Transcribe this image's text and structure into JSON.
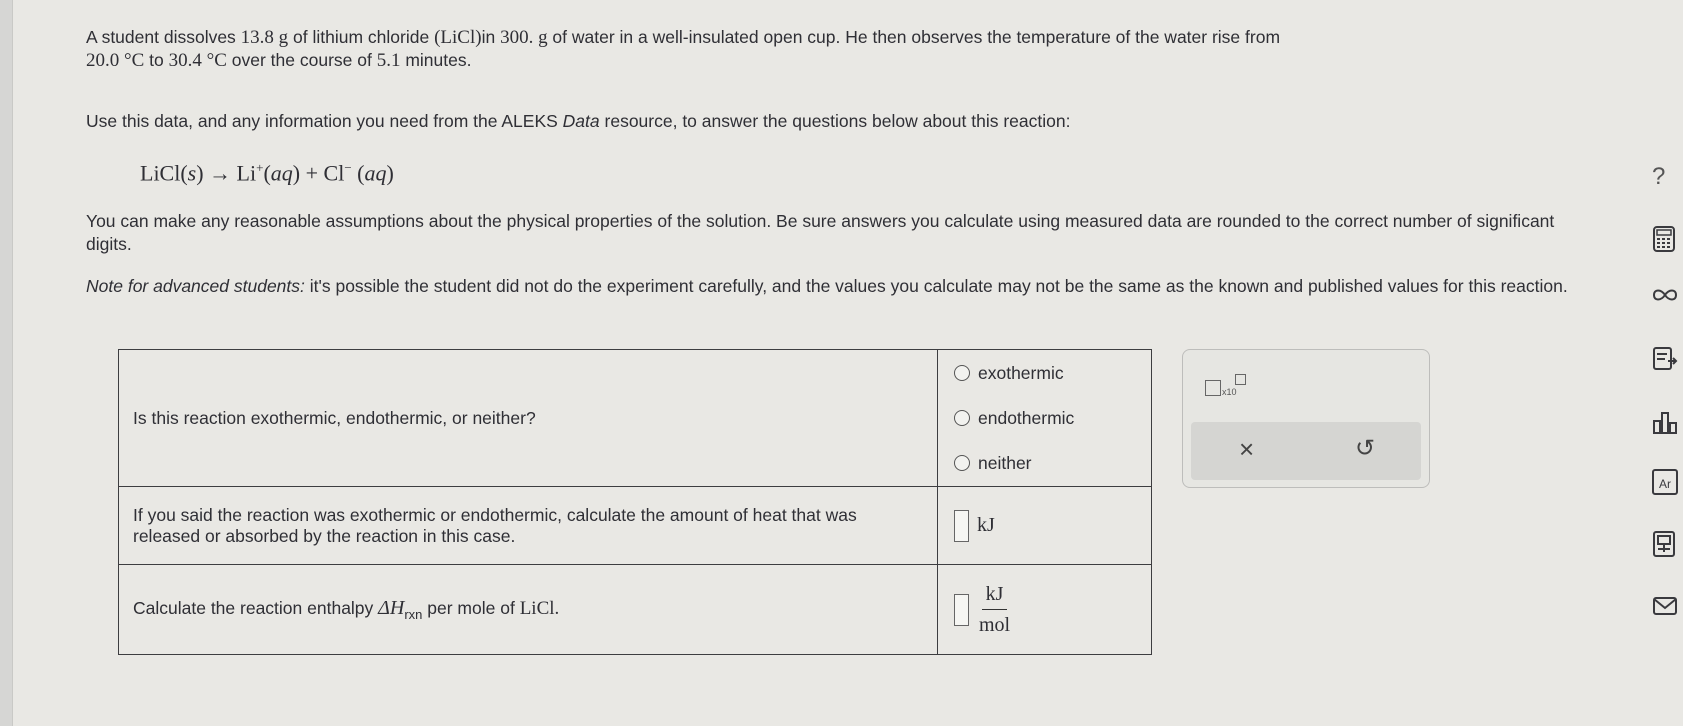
{
  "problem": {
    "p1_a": "A student dissolves ",
    "mass_value": "13.8",
    "mass_unit": " g",
    "p1_b": " of lithium chloride ",
    "formula": "(LiCl)",
    "p1_c": "in ",
    "water_value": "300.",
    "water_unit": " g",
    "p1_d": " of water in a well-insulated open cup. He then observes the temperature of the water rise from",
    "t1": "20.0 °C",
    "p1_e": " to ",
    "t2": "30.4 °C",
    "p1_f": " over the course of ",
    "minutes": "5.1",
    "p1_g": " minutes.",
    "p2_a": "Use this data, and any information you need from the ALEKS ",
    "p2_italic": "Data",
    "p2_b": " resource, to answer the questions below about this reaction:",
    "eq_lhs": "LiCl(",
    "eq_s": "s",
    "eq_mid1": ")  →  Li",
    "eq_sup1": "+",
    "eq_mid2": "(",
    "eq_aq1": "aq",
    "eq_mid3": ")  +  Cl",
    "eq_sup2": "−",
    "eq_mid4": " (",
    "eq_aq2": "aq",
    "eq_end": ")",
    "p3": "You can make any reasonable assumptions about the physical properties of the solution. Be sure answers you calculate using measured data are rounded to the correct number of significant digits.",
    "note_label": "Note for advanced students:",
    "note_text": " it's possible the student did not do the experiment carefully, and the values you calculate may not be the same as the known and published values for this reaction."
  },
  "table": {
    "q1": "Is this reaction exothermic, endothermic, or neither?",
    "options": [
      "exothermic",
      "endothermic",
      "neither"
    ],
    "q2": "If you said the reaction was exothermic or endothermic, calculate the amount of heat that was released or absorbed by the reaction in this case.",
    "q2_unit": "kJ",
    "q3_a": "Calculate the reaction enthalpy ",
    "q3_dh": "ΔH",
    "q3_sub": "rxn",
    "q3_b": " per mole of ",
    "q3_formula": "LiCl.",
    "q3_unit_num": "kJ",
    "q3_unit_den": "mol"
  },
  "tools": {
    "sci_label": "x10",
    "clear": "×",
    "undo": "↺"
  },
  "sidebar": {
    "help": "?",
    "periodic": "Ar"
  }
}
